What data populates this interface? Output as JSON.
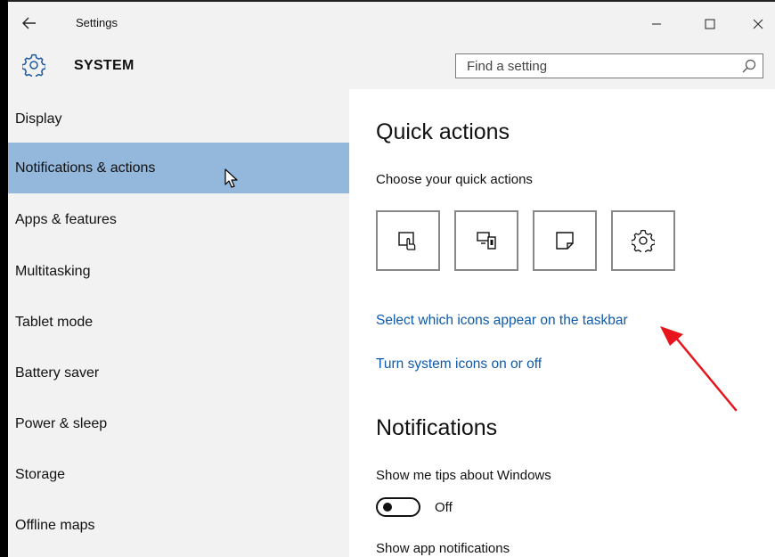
{
  "window": {
    "title": "Settings",
    "back_icon": "back-arrow-icon",
    "controls": [
      "minimize-icon",
      "maximize-icon",
      "close-icon"
    ]
  },
  "header": {
    "section_title": "SYSTEM",
    "section_icon": "gear-icon",
    "search": {
      "placeholder": "Find a setting",
      "icon": "search-icon"
    }
  },
  "sidebar": {
    "items": [
      {
        "label": "Display",
        "active": false
      },
      {
        "label": "Notifications & actions",
        "active": true
      },
      {
        "label": "Apps & features",
        "active": false
      },
      {
        "label": "Multitasking",
        "active": false
      },
      {
        "label": "Tablet mode",
        "active": false
      },
      {
        "label": "Battery saver",
        "active": false
      },
      {
        "label": "Power & sleep",
        "active": false
      },
      {
        "label": "Storage",
        "active": false
      },
      {
        "label": "Offline maps",
        "active": false
      }
    ]
  },
  "content": {
    "quick_actions": {
      "heading": "Quick actions",
      "subheading": "Choose your quick actions",
      "tiles": [
        {
          "icon": "tablet-mode-icon"
        },
        {
          "icon": "project-icon"
        },
        {
          "icon": "note-icon"
        },
        {
          "icon": "settings-gear-icon"
        }
      ],
      "links": [
        "Select which icons appear on the taskbar",
        "Turn system icons on or off"
      ]
    },
    "notifications": {
      "heading": "Notifications",
      "tips_label": "Show me tips about Windows",
      "tips_toggle": {
        "state": "Off",
        "on": false
      },
      "app_notifications_label": "Show app notifications"
    }
  },
  "annotation": {
    "icon": "red-arrow-annotation",
    "color": "#e8141b"
  },
  "colors": {
    "selected_item": "#93b8dc",
    "link": "#0f5aa8",
    "chrome": "#f2f2f2"
  }
}
